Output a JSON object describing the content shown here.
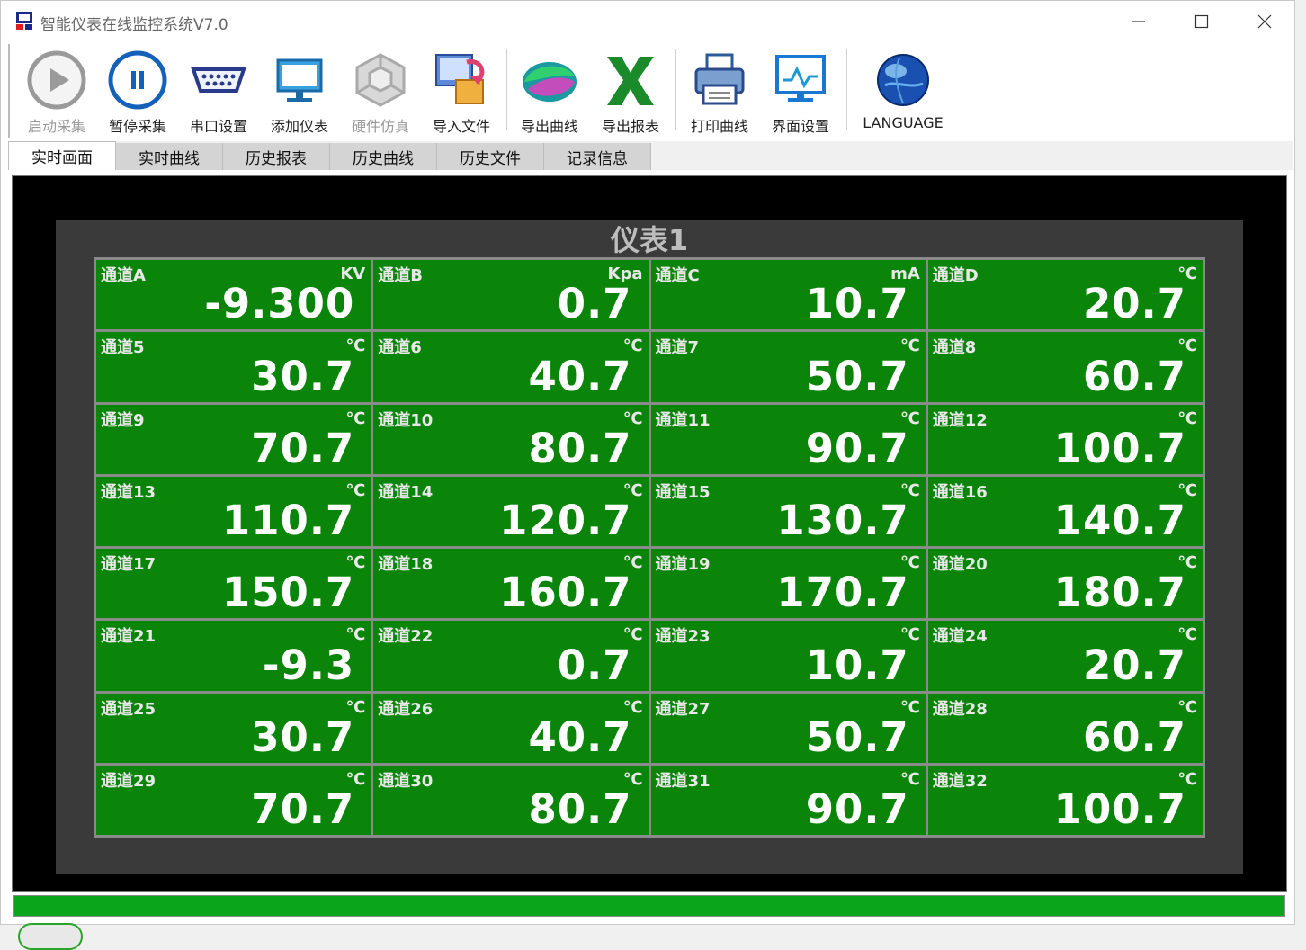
{
  "window": {
    "title": "智能仪表在线监控系统V7.0",
    "controls": [
      "minimize",
      "maximize",
      "close"
    ]
  },
  "toolbar": {
    "items": [
      {
        "label": "启动采集",
        "icon": "play-icon",
        "enabled": false
      },
      {
        "label": "暂停采集",
        "icon": "pause-icon",
        "enabled": true
      },
      {
        "label": "串口设置",
        "icon": "serial-port-icon",
        "enabled": true
      },
      {
        "label": "添加仪表",
        "icon": "monitor-icon",
        "enabled": true
      },
      {
        "label": "硬件仿真",
        "icon": "cube-icon",
        "enabled": false
      },
      {
        "label": "导入文件",
        "icon": "import-file-icon",
        "enabled": true
      },
      {
        "label": "导出曲线",
        "icon": "export-curve-icon",
        "enabled": true
      },
      {
        "label": "导出报表",
        "icon": "excel-icon",
        "enabled": true
      },
      {
        "label": "打印曲线",
        "icon": "printer-icon",
        "enabled": true
      },
      {
        "label": "界面设置",
        "icon": "screen-settings-icon",
        "enabled": true
      },
      {
        "label": "LANGUAGE",
        "icon": "globe-icon",
        "enabled": true
      }
    ]
  },
  "tabs": [
    {
      "label": "实时画面",
      "active": true
    },
    {
      "label": "实时曲线",
      "active": false
    },
    {
      "label": "历史报表",
      "active": false
    },
    {
      "label": "历史曲线",
      "active": false
    },
    {
      "label": "历史文件",
      "active": false
    },
    {
      "label": "记录信息",
      "active": false
    }
  ],
  "meter": {
    "title": "仪表1",
    "channels": [
      {
        "name": "通道A",
        "unit": "KV",
        "value": "-9.300"
      },
      {
        "name": "通道B",
        "unit": "Kpa",
        "value": "0.7"
      },
      {
        "name": "通道C",
        "unit": "mA",
        "value": "10.7"
      },
      {
        "name": "通道D",
        "unit": "℃",
        "value": "20.7"
      },
      {
        "name": "通道5",
        "unit": "℃",
        "value": "30.7"
      },
      {
        "name": "通道6",
        "unit": "℃",
        "value": "40.7"
      },
      {
        "name": "通道7",
        "unit": "℃",
        "value": "50.7"
      },
      {
        "name": "通道8",
        "unit": "℃",
        "value": "60.7"
      },
      {
        "name": "通道9",
        "unit": "℃",
        "value": "70.7"
      },
      {
        "name": "通道10",
        "unit": "℃",
        "value": "80.7"
      },
      {
        "name": "通道11",
        "unit": "℃",
        "value": "90.7"
      },
      {
        "name": "通道12",
        "unit": "℃",
        "value": "100.7"
      },
      {
        "name": "通道13",
        "unit": "℃",
        "value": "110.7"
      },
      {
        "name": "通道14",
        "unit": "℃",
        "value": "120.7"
      },
      {
        "name": "通道15",
        "unit": "℃",
        "value": "130.7"
      },
      {
        "name": "通道16",
        "unit": "℃",
        "value": "140.7"
      },
      {
        "name": "通道17",
        "unit": "℃",
        "value": "150.7"
      },
      {
        "name": "通道18",
        "unit": "℃",
        "value": "160.7"
      },
      {
        "name": "通道19",
        "unit": "℃",
        "value": "170.7"
      },
      {
        "name": "通道20",
        "unit": "℃",
        "value": "180.7"
      },
      {
        "name": "通道21",
        "unit": "℃",
        "value": "-9.3"
      },
      {
        "name": "通道22",
        "unit": "℃",
        "value": "0.7"
      },
      {
        "name": "通道23",
        "unit": "℃",
        "value": "10.7"
      },
      {
        "name": "通道24",
        "unit": "℃",
        "value": "20.7"
      },
      {
        "name": "通道25",
        "unit": "℃",
        "value": "30.7"
      },
      {
        "name": "通道26",
        "unit": "℃",
        "value": "40.7"
      },
      {
        "name": "通道27",
        "unit": "℃",
        "value": "50.7"
      },
      {
        "name": "通道28",
        "unit": "℃",
        "value": "60.7"
      },
      {
        "name": "通道29",
        "unit": "℃",
        "value": "70.7"
      },
      {
        "name": "通道30",
        "unit": "℃",
        "value": "80.7"
      },
      {
        "name": "通道31",
        "unit": "℃",
        "value": "90.7"
      },
      {
        "name": "通道32",
        "unit": "℃",
        "value": "100.7"
      }
    ]
  },
  "colors": {
    "cell_bg": "#0a850a",
    "panel_bg": "#3a3a3a",
    "content_bg": "#000000",
    "status_bar": "#0aa51a"
  }
}
